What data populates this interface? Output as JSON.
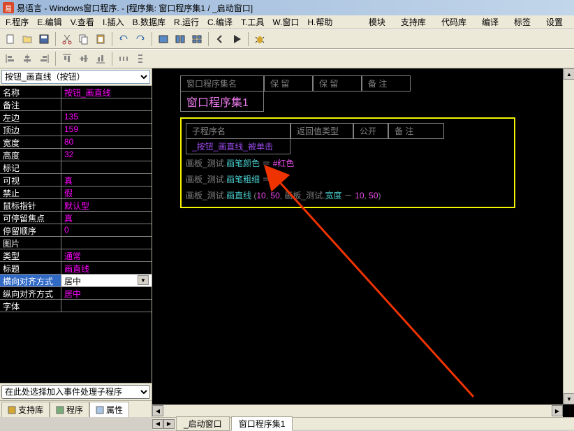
{
  "title": "易语言 - Windows窗口程序. - [程序集: 窗口程序集1 / _启动窗口]",
  "menu": {
    "items": [
      "F.程序",
      "E.编辑",
      "V.查看",
      "I.插入",
      "B.数据库",
      "R.运行",
      "C.编译",
      "T.工具",
      "W.窗口",
      "H.帮助"
    ],
    "right": [
      "模块",
      "支持库",
      "代码库",
      "编译",
      "标签",
      "设置"
    ]
  },
  "left": {
    "object_selector": "按钮_画直线（按钮）",
    "event_selector": "在此处选择加入事件处理子程序",
    "props": [
      {
        "label": "名称",
        "value": "按钮_画直线"
      },
      {
        "label": "备注",
        "value": ""
      },
      {
        "label": "左边",
        "value": "135"
      },
      {
        "label": "顶边",
        "value": "159"
      },
      {
        "label": "宽度",
        "value": "80"
      },
      {
        "label": "高度",
        "value": "32"
      },
      {
        "label": "标记",
        "value": ""
      },
      {
        "label": "可视",
        "value": "真"
      },
      {
        "label": "禁止",
        "value": "假"
      },
      {
        "label": "鼠标指针",
        "value": "默认型"
      },
      {
        "label": "可停留焦点",
        "value": "真"
      },
      {
        "label": "  停留顺序",
        "value": "0"
      },
      {
        "label": "图片",
        "value": ""
      },
      {
        "label": "类型",
        "value": "通常"
      },
      {
        "label": "标题",
        "value": "画直线"
      },
      {
        "label": "横向对齐方式",
        "value": "居中",
        "selected": true
      },
      {
        "label": "纵向对齐方式",
        "value": "居中"
      },
      {
        "label": "字体",
        "value": ""
      }
    ],
    "tabs": [
      "支持库",
      "程序",
      "属性"
    ]
  },
  "editor": {
    "top_tabs": {
      "col1": "窗口程序集名",
      "col2": "保  留",
      "col3": "保  留",
      "col4": "备  注"
    },
    "top_active": "窗口程序集1",
    "sub_header": {
      "c1": "子程序名",
      "c2": "返回值类型",
      "c3": "公开",
      "c4": "备  注"
    },
    "sub_name": "_按钮_画直线_被单击",
    "lines": {
      "l1a": "画板_测试.",
      "l1b": "画笔颜色",
      "l1c": " ＝ ",
      "l1d": "#红色",
      "l2a": "画板_测试.",
      "l2b": "画笔粗细",
      "l2c": " ＝ ",
      "l2d": "5",
      "l3a": "画板_测试.",
      "l3b": "画直线",
      "l3c": " (",
      "l3d": "10",
      "l3e": ", ",
      "l3f": "50",
      "l3g": ", 画板_测试.",
      "l3h": "宽度",
      "l3i": " － ",
      "l3j": "10",
      "l3k": ", ",
      "l3l": "50",
      "l3m": ")"
    },
    "bottom_tabs": [
      "_启动窗口",
      "窗口程序集1"
    ]
  }
}
